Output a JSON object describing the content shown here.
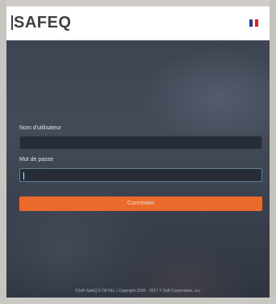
{
  "header": {
    "logo_text": "SAFEQ",
    "language_flag_colors": [
      "#1f3fa6",
      "#ffffff",
      "#e1202d"
    ],
    "language_icon": "flag-icon"
  },
  "form": {
    "username_label": "Nom d'utilisateur",
    "username_value": "",
    "password_label": "Mot de passe",
    "password_value": "",
    "submit_label": "Connexion"
  },
  "footer": {
    "text": "YSoft SafeQ 6 DEYEL | Copyright 2000 - 2017 Y Soft Corporation, a.s."
  },
  "colors": {
    "accent": "#ea6a2c",
    "background": "#39404d",
    "header": "#ffffff"
  }
}
